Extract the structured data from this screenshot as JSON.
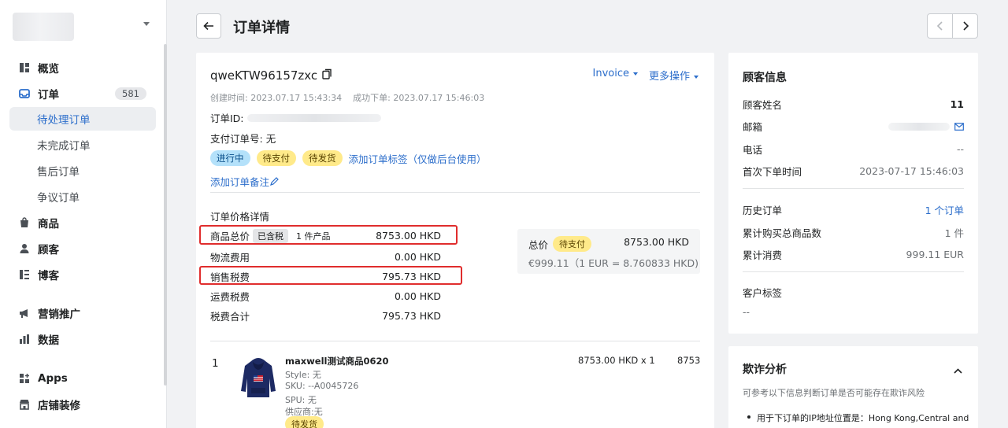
{
  "sidebar": {
    "nav": [
      {
        "label": "概览",
        "icon": "dashboard-icon",
        "type": "main"
      },
      {
        "label": "订单",
        "icon": "inbox-icon",
        "type": "main",
        "count": "581"
      },
      {
        "label": "待处理订单",
        "type": "sub",
        "active": true
      },
      {
        "label": "未完成订单",
        "type": "sub"
      },
      {
        "label": "售后订单",
        "type": "sub"
      },
      {
        "label": "争议订单",
        "type": "sub"
      },
      {
        "label": "商品",
        "icon": "tag-icon",
        "type": "main"
      },
      {
        "label": "顾客",
        "icon": "person-icon",
        "type": "main"
      },
      {
        "label": "博客",
        "icon": "blog-icon",
        "type": "main"
      },
      {
        "label": "营销推广",
        "icon": "megaphone-icon",
        "type": "main"
      },
      {
        "label": "数据",
        "icon": "bar-chart-icon",
        "type": "main"
      },
      {
        "label": "Apps",
        "icon": "apps-icon",
        "type": "main"
      },
      {
        "label": "店铺装修",
        "icon": "store-icon",
        "type": "main"
      }
    ]
  },
  "header": {
    "title": "订单详情"
  },
  "order": {
    "number": "qweKTW96157zxc",
    "actions": {
      "invoice": "Invoice",
      "more": "更多操作"
    },
    "created_label": "创建时间:",
    "created_value": "2023.07.17 15:43:34",
    "placed_label": "成功下单:",
    "placed_value": "2023.07.17 15:46:03",
    "order_id_label": "订单ID:",
    "payment_no_label": "支付订单号:",
    "payment_no_value": "无",
    "badges": {
      "status": "进行中",
      "payment": "待支付",
      "fulfillment": "待发货"
    },
    "add_tag": "添加订单标签（仅做后台使用）",
    "add_note": "添加订单备注"
  },
  "price": {
    "title": "订单价格详情",
    "subtotal_label": "商品总价",
    "tax_included": "已含税",
    "item_count": "1 件产品",
    "subtotal": "8753.00 HKD",
    "shipping_label": "物流费用",
    "shipping": "0.00 HKD",
    "sales_tax_label": "销售税费",
    "sales_tax": "795.73 HKD",
    "freight_tax_label": "运费税费",
    "freight_tax": "0.00 HKD",
    "tax_total_label": "税费合计",
    "tax_total": "795.73 HKD",
    "total_label": "总价",
    "total_status": "待支付",
    "total": "8753.00 HKD",
    "converted": "€999.11（1 EUR = 8.760833 HKD)"
  },
  "line_item": {
    "index": "1",
    "name": "maxwell测试商品0620",
    "style": "Style: 无",
    "sku": "SKU: --A0045726",
    "spu": "SPU: 无",
    "supplier": "供应商:无",
    "unit_price": "8753.00 HKD x 1",
    "line_total": "8753.",
    "status": "待发货"
  },
  "customer": {
    "title": "顾客信息",
    "name_label": "顾客姓名",
    "name_value": "11",
    "email_label": "邮箱",
    "phone_label": "电话",
    "phone_value": "--",
    "first_order_label": "首次下单时间",
    "first_order_value": "2023-07-17 15:46:03",
    "history_label": "历史订单",
    "history_value": "1 个订单",
    "items_label": "累计购买总商品数",
    "items_value": "1 件",
    "spent_label": "累计消费",
    "spent_value": "999.11 EUR",
    "tags_label": "客户标签",
    "tags_value": "--"
  },
  "fraud": {
    "title": "欺诈分析",
    "desc": "可参考以下信息判断订单是否可能存在欺诈风险",
    "item": "用于下订单的IP地址位置是：Hong Kong,Central and"
  }
}
